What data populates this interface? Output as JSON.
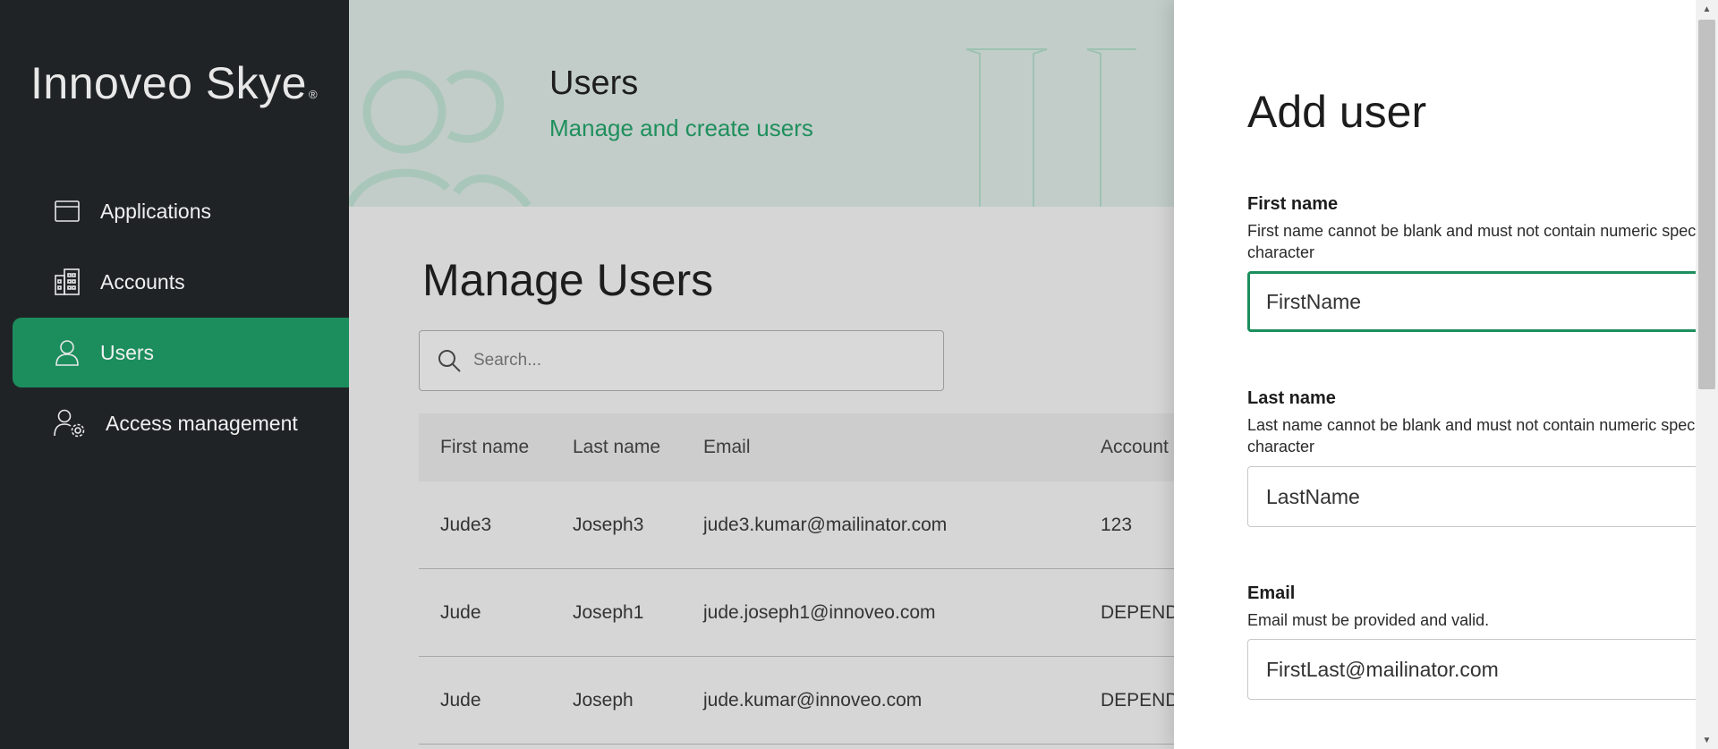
{
  "sidebar": {
    "logo": "Innoveo Skye",
    "logo_mark": "®",
    "items": [
      {
        "label": "Applications",
        "icon": "window-icon",
        "active": false
      },
      {
        "label": "Accounts",
        "icon": "building-icon",
        "active": false
      },
      {
        "label": "Users",
        "icon": "user-icon",
        "active": true
      },
      {
        "label": "Access management",
        "icon": "user-gear-icon",
        "active": false
      }
    ]
  },
  "banner": {
    "title": "Users",
    "subtitle": "Manage and create users"
  },
  "main": {
    "title": "Manage Users",
    "search": {
      "placeholder": "Search..."
    },
    "table": {
      "headers": [
        "First name",
        "Last name",
        "Email",
        "Account"
      ],
      "rows": [
        [
          "Jude3",
          "Joseph3",
          "jude3.kumar@mailinator.com",
          "123"
        ],
        [
          "Jude",
          "Joseph1",
          "jude.joseph1@innoveo.com",
          "DEPEND"
        ],
        [
          "Jude",
          "Joseph",
          "jude.kumar@innoveo.com",
          "DEPEND"
        ]
      ]
    }
  },
  "drawer": {
    "title": "Add user",
    "fields": [
      {
        "label": "First name",
        "help": "First name cannot be blank and must not contain numeric special character",
        "value": "FirstName"
      },
      {
        "label": "Last name",
        "help": "Last name cannot be blank and must not contain numeric special character",
        "value": "LastName"
      },
      {
        "label": "Email",
        "help": "Email must be provided and valid.",
        "value": "FirstLast@mailinator.com"
      }
    ]
  },
  "colors": {
    "accent": "#1c8e5d",
    "sidebar_bg": "#1f2326",
    "banner_bg": "#c2cdc9"
  }
}
